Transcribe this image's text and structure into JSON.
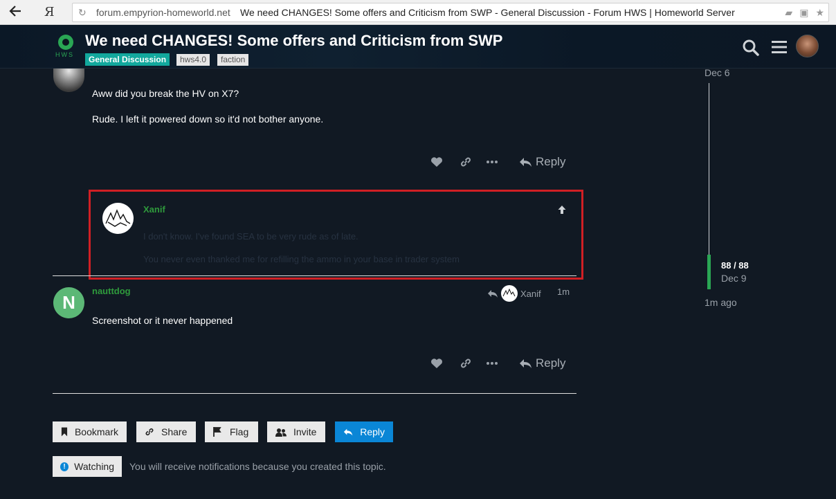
{
  "browser": {
    "back_icon": "back-arrow-icon",
    "yandex_label": "Я",
    "domain": "forum.empyrion-homeworld.net",
    "page_title": "We need CHANGES! Some offers and Criticism from SWP - General Discussion - Forum HWS | Homeworld Server"
  },
  "header": {
    "logo_text": "HWS",
    "title": "We need CHANGES! Some offers and Criticism from SWP",
    "category": "General Discussion",
    "tags": [
      "hws4.0",
      "faction"
    ],
    "accent_color": "#12a89d"
  },
  "posts": {
    "first": {
      "lines": [
        "Aww did you break the HV on X7?",
        "Rude. I left it powered down so it'd not bother anyone."
      ],
      "reply_label": "Reply"
    },
    "quoted": {
      "author": "Xanif",
      "lines": [
        "I don't know. I've found SEA to be very rude as of late.",
        "You never even thanked me for refilling the ammo in your base in trader system"
      ]
    },
    "second": {
      "author": "nauttdog",
      "avatar_letter": "N",
      "reply_to": "Xanif",
      "age": "1m",
      "text": "Screenshot or it never happened",
      "reply_label": "Reply"
    }
  },
  "footer_buttons": {
    "bookmark": "Bookmark",
    "share": "Share",
    "flag": "Flag",
    "invite": "Invite",
    "reply": "Reply",
    "watching": "Watching",
    "notification": "You will receive notifications because you created this topic."
  },
  "timeline": {
    "top_date": "Dec 6",
    "count": "88 / 88",
    "date": "Dec 9",
    "ago": "1m ago",
    "progress": 1.0
  }
}
